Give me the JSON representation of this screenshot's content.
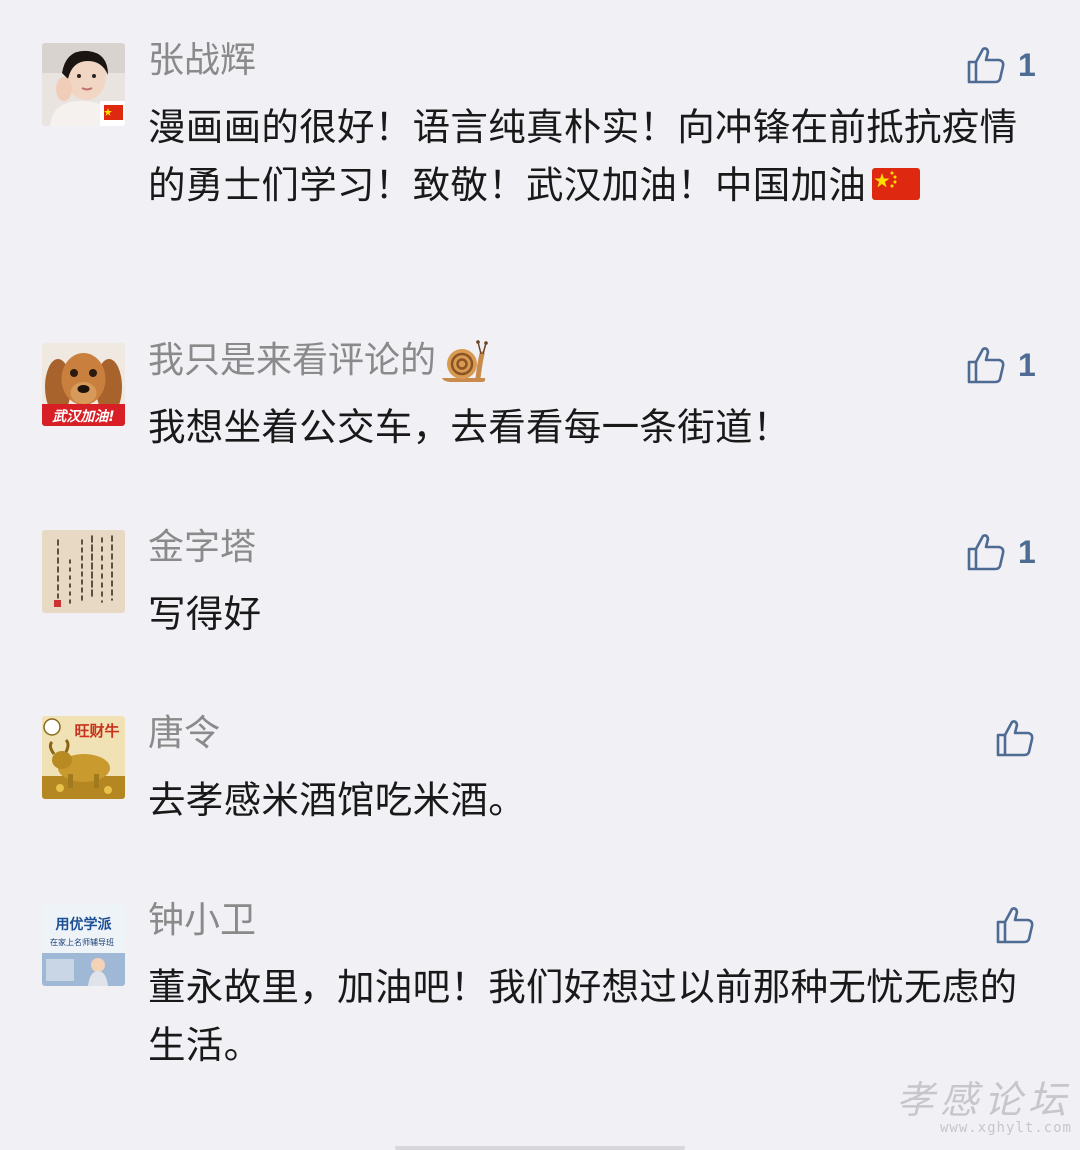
{
  "comments": [
    {
      "name": "张战辉",
      "text": "漫画画的很好！语言纯真朴实！向冲锋在前抵抗疫情的勇士们学习！致敬！武汉加油！中国加油",
      "likes": "1",
      "avatar": "person-photo-with-flag"
    },
    {
      "name": "我只是来看评论的",
      "text": "我想坐着公交车，去看看每一条街道！",
      "likes": "1",
      "avatar": "dog-photo",
      "avatar_label": "武汉加油!"
    },
    {
      "name": "金字塔",
      "text": "写得好",
      "likes": "1",
      "avatar": "calligraphy-scroll"
    },
    {
      "name": "唐令",
      "text": "去孝感米酒馆吃米酒。",
      "likes": "",
      "avatar": "golden-bull",
      "avatar_label": "旺财牛"
    },
    {
      "name": "钟小卫",
      "text": "董永故里，加油吧！我们好想过以前那种无忧无虑的生活。",
      "likes": "",
      "avatar": "education-ad",
      "avatar_label": "用优学派",
      "avatar_sublabel": "在家上名师辅导班"
    }
  ],
  "watermark": {
    "main": "孝感论坛",
    "url": "www.xghylt.com"
  },
  "colors": {
    "background": "#f1f0f5",
    "name": "#8a8a8a",
    "text": "#191919",
    "like": "#4d6b93"
  },
  "icons": {
    "like": "thumbs-up-icon",
    "flag": "china-flag-icon",
    "snail": "snail-emoji-icon"
  }
}
